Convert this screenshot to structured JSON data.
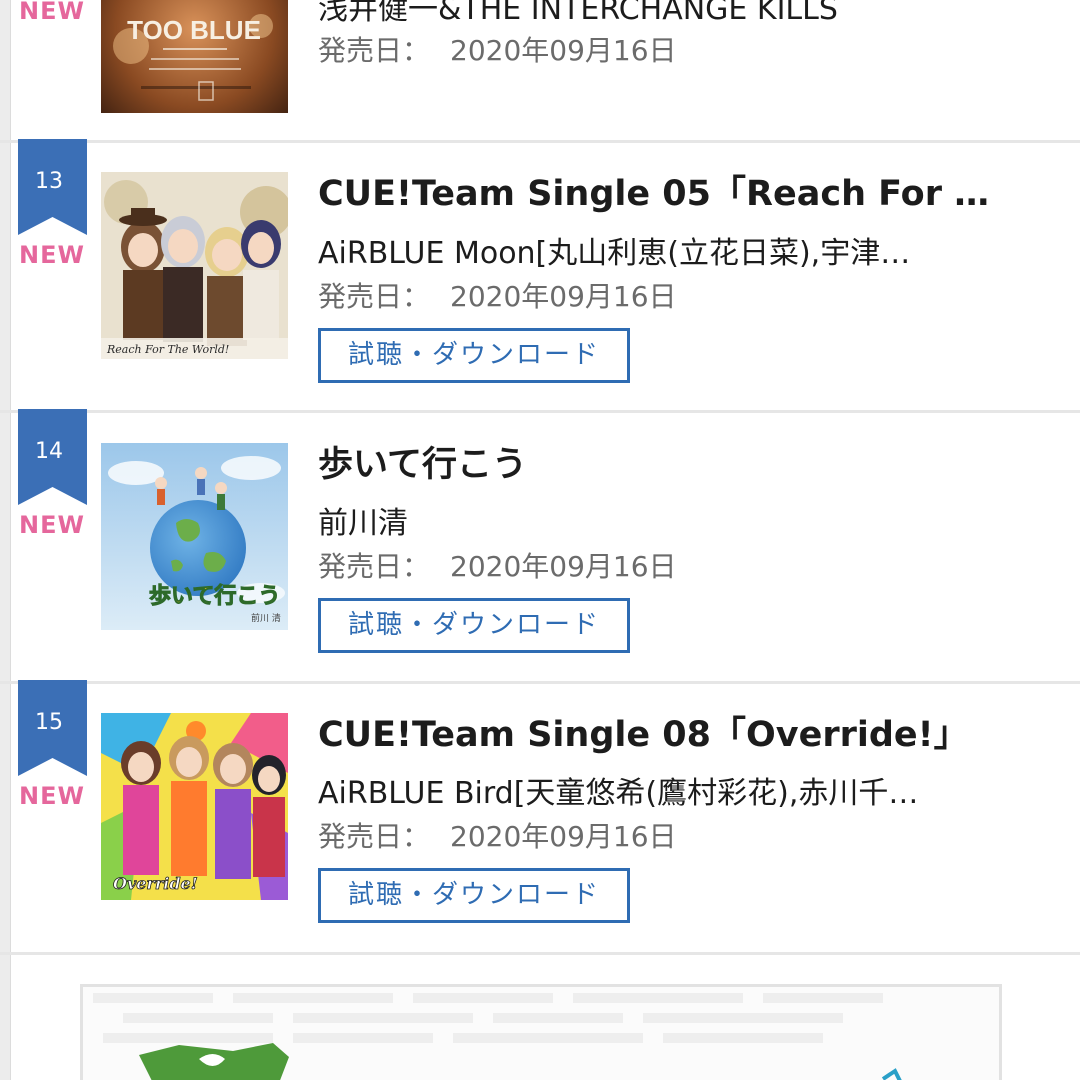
{
  "items": [
    {
      "new_label": "NEW",
      "title": "",
      "artist": "浅井健一&THE INTERCHANGE KILLS",
      "release_label": "発売日：",
      "release_date": "2020年09月16日",
      "cover_text": "TOO BLUE"
    },
    {
      "rank": "13",
      "new_label": "NEW",
      "title": "CUE!Team Single 05「Reach For …",
      "artist": "AiRBLUE Moon[丸山利恵(立花日菜),宇津…",
      "release_label": "発売日：",
      "release_date": "2020年09月16日",
      "button_label": "試聴・ダウンロード",
      "cover_text": "Reach For The World!"
    },
    {
      "rank": "14",
      "new_label": "NEW",
      "title": "歩いて行こう",
      "artist": "前川清",
      "release_label": "発売日：",
      "release_date": "2020年09月16日",
      "button_label": "試聴・ダウンロード",
      "cover_text": "歩いて行こう",
      "cover_subtext": "前川 清"
    },
    {
      "rank": "15",
      "new_label": "NEW",
      "title": "CUE!Team Single 08「Override!」",
      "artist": "AiRBLUE Bird[天童悠希(鷹村彩花),赤川千…",
      "release_label": "発売日：",
      "release_date": "2020年09月16日",
      "button_label": "試聴・ダウンロード",
      "cover_text": "Override!"
    }
  ],
  "colors": {
    "rank_ribbon": "#3b6fb6",
    "new_label": "#e5679c",
    "button_border": "#2f6cb3",
    "divider": "#e6e6e6"
  }
}
